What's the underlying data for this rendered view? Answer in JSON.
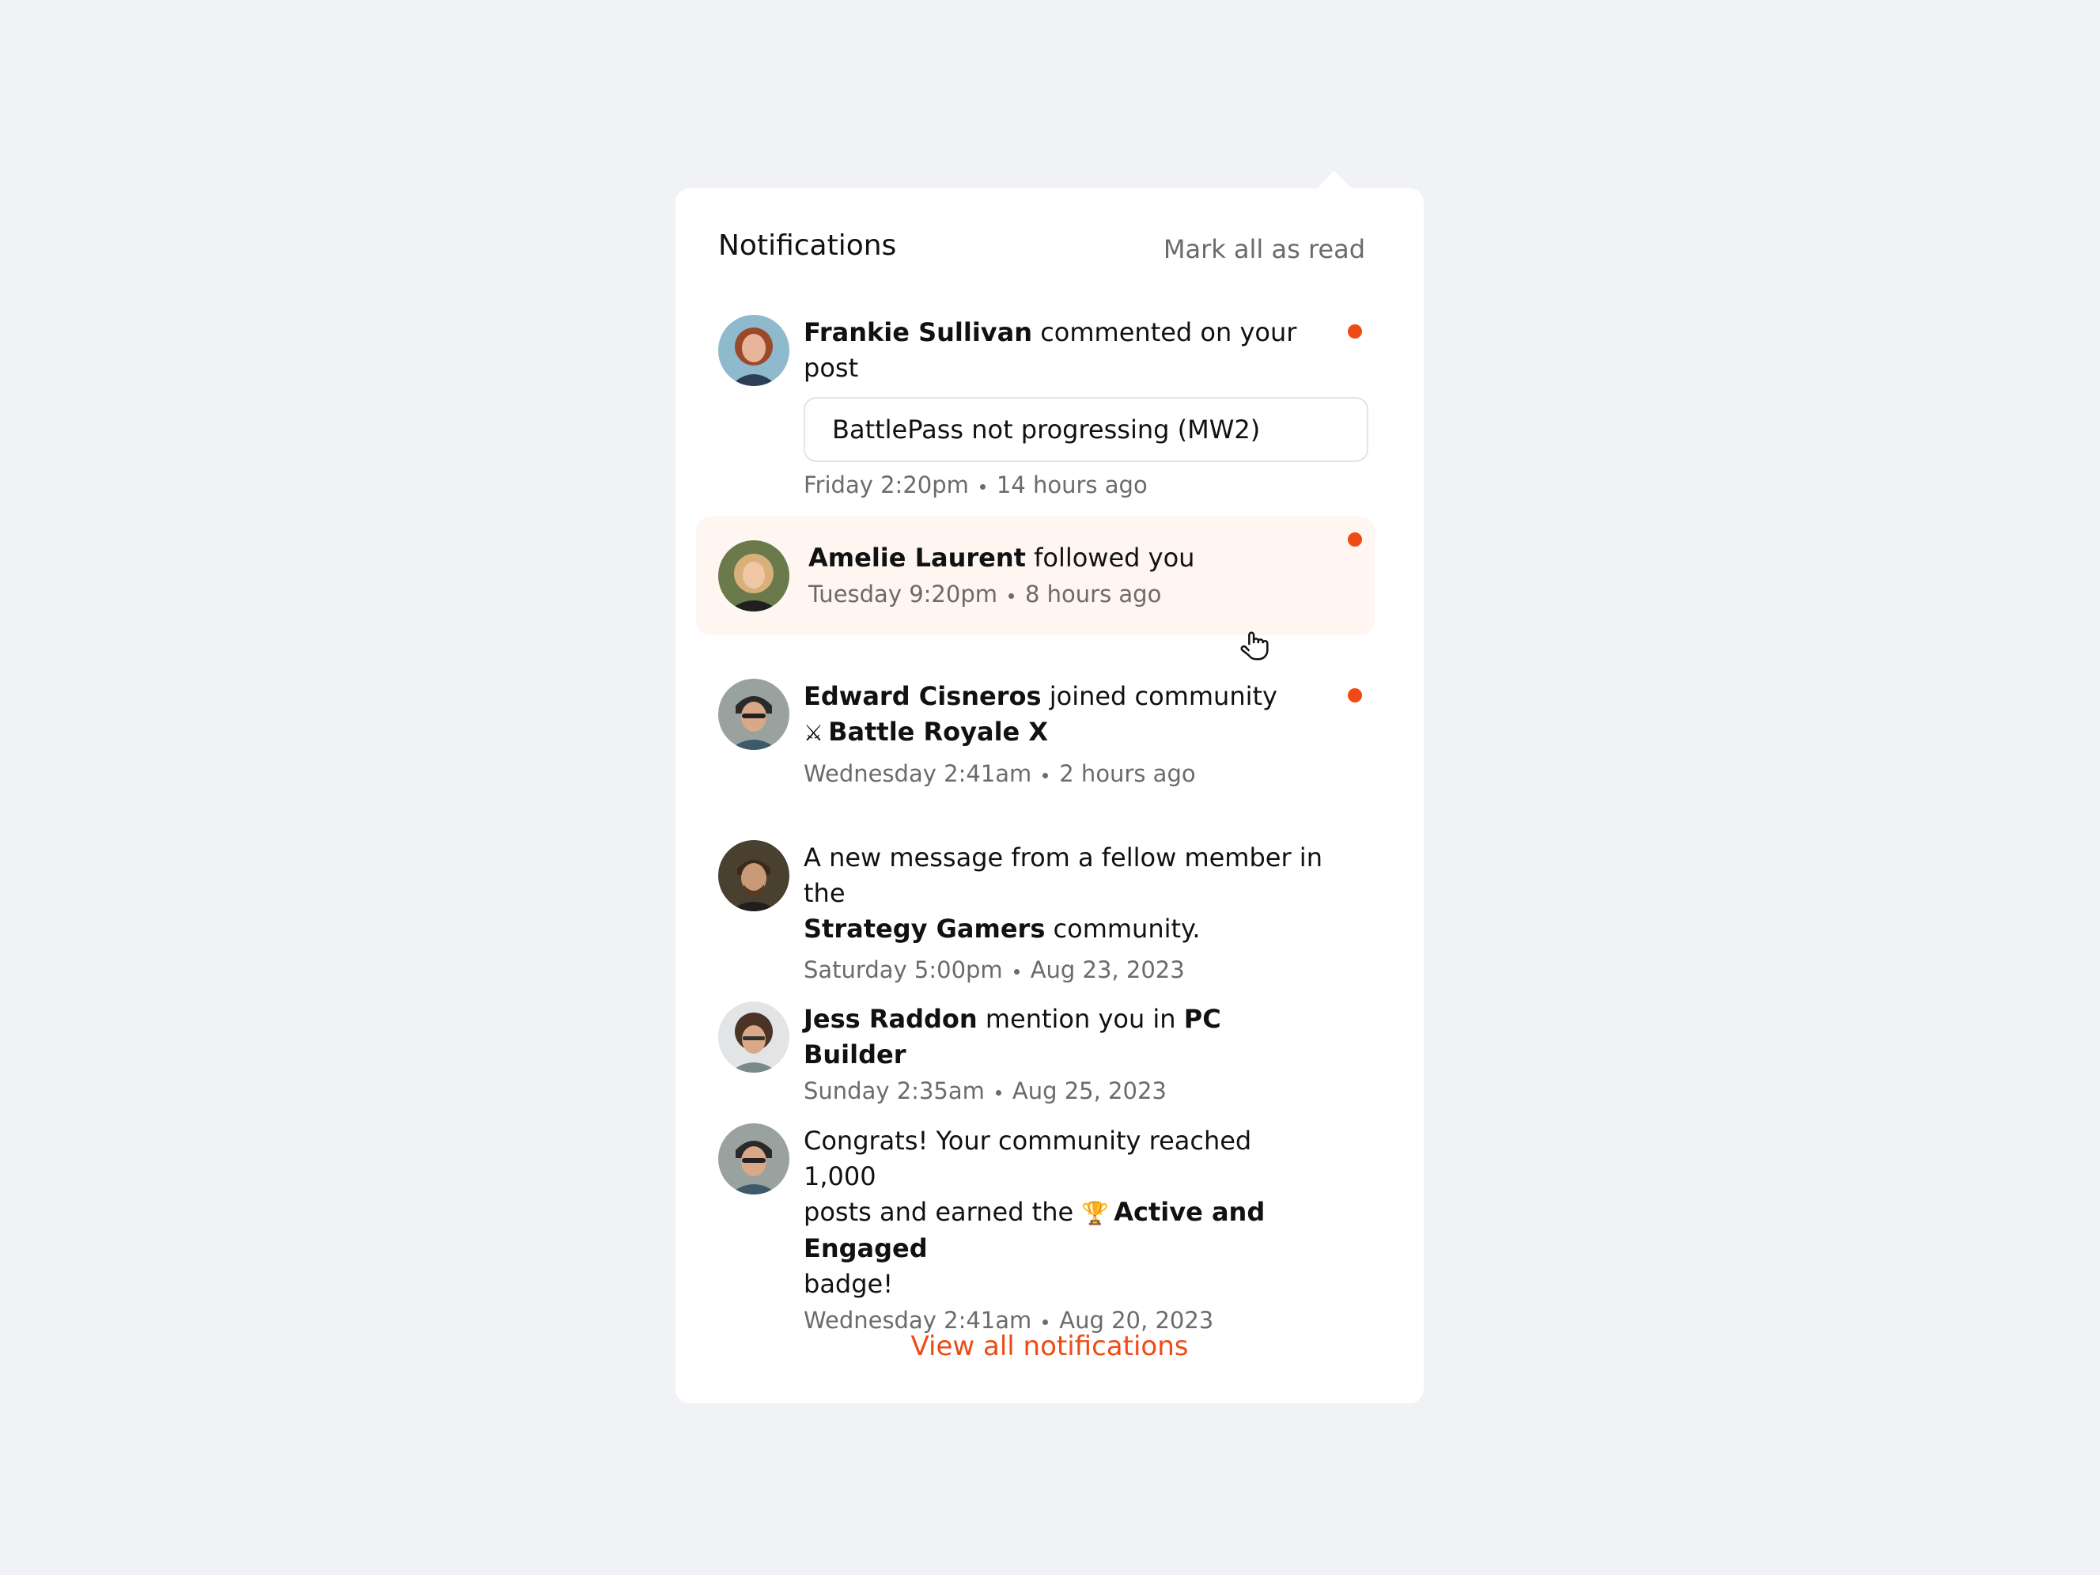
{
  "header": {
    "title": "Notifications",
    "mark_all": "Mark all as read"
  },
  "colors": {
    "accent": "#f04a14",
    "background": "#f1f2f5",
    "highlight": "#fff5f1",
    "muted": "#6b6b6b"
  },
  "notifications": [
    {
      "name": "Frankie Sullivan",
      "action": "commented on your post",
      "post_title": "BattlePass not progressing (MW2)",
      "day": "Friday 2:20pm",
      "ago": "14 hours ago",
      "unread": true
    },
    {
      "name": "Amelie Laurent",
      "action": "followed you",
      "day": "Tuesday 9:20pm",
      "ago": "8 hours ago",
      "unread": true,
      "hovered": true
    },
    {
      "name": "Edward Cisneros",
      "action": "joined community",
      "community_icon": "crossed-swords-icon",
      "community": "Battle Royale X",
      "day": "Wednesday 2:41am",
      "ago": "2 hours ago",
      "unread": true
    },
    {
      "text_before": "A new message from a fellow member in the",
      "community": "Strategy Gamers",
      "text_after": "community.",
      "day": "Saturday 5:00pm",
      "ago": "Aug 23, 2023",
      "unread": false
    },
    {
      "name": "Jess Raddon",
      "action": "mention you in",
      "target": "PC Builder",
      "day": "Sunday 2:35am",
      "ago": "Aug 25, 2023",
      "unread": false
    },
    {
      "text_line1": "Congrats! Your community reached 1,000",
      "text_line2_before": "posts and earned the",
      "badge_icon": "trophy-icon",
      "badge": "Active and Engaged",
      "text_line3": "badge!",
      "day": "Wednesday 2:41am",
      "ago": "Aug 20, 2023",
      "unread": false
    }
  ],
  "footer": {
    "view_all": "View all notifications"
  }
}
